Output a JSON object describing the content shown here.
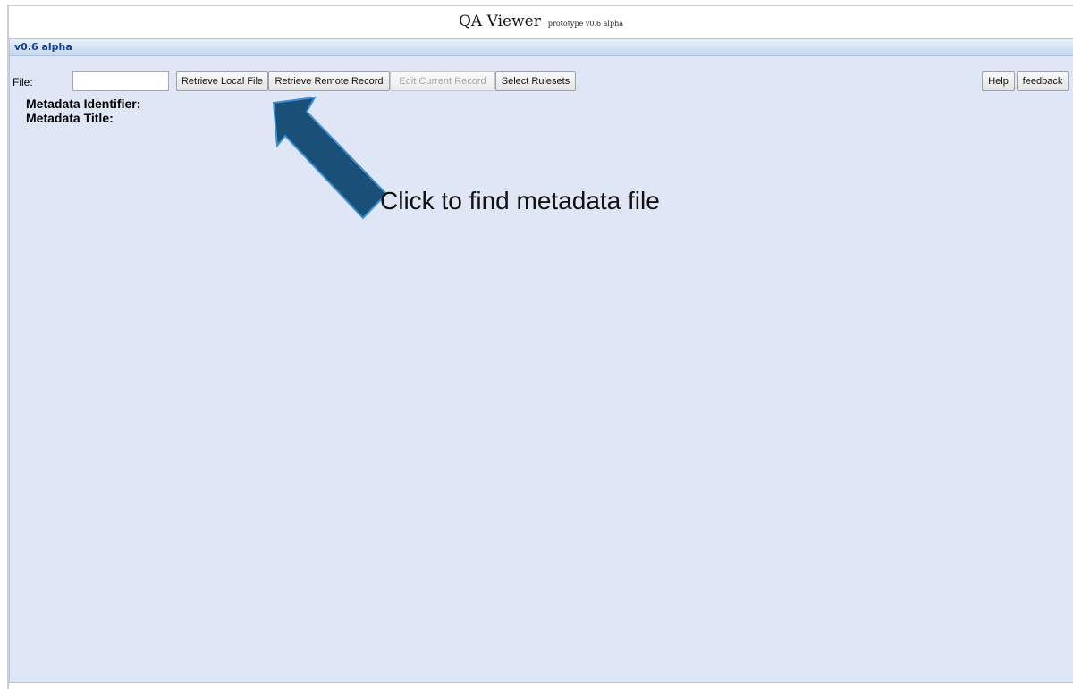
{
  "header": {
    "title": "QA Viewer",
    "subtitle": "prototype v0.6 alpha"
  },
  "panel": {
    "title": "v0.6 alpha"
  },
  "toolbar": {
    "file_label": "File:",
    "file_value": "",
    "retrieve_local_label": "Retrieve Local File",
    "retrieve_remote_label": "Retrieve Remote Record",
    "edit_current_label": "Edit Current Record",
    "select_rulesets_label": "Select Rulesets",
    "help_label": "Help",
    "feedback_label": "feedback"
  },
  "metadata": {
    "identifier_label": "Metadata Identifier:",
    "title_label": "Metadata Title:"
  },
  "annotation": {
    "text": "Click to find metadata file",
    "arrow_icon": "arrow-up-left-icon",
    "arrow_color": "#1a4f78",
    "arrow_outline": "#3d8fd1"
  },
  "colors": {
    "panel_background": "#dfe6f6",
    "panel_title": "#15428b",
    "disabled_text": "#a9a9a9"
  }
}
